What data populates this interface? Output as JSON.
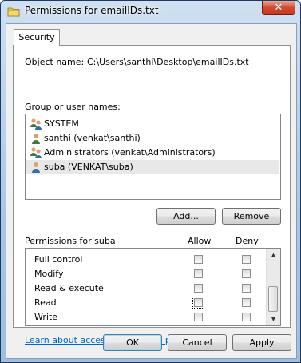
{
  "window": {
    "title": "Permissions for emailIDs.txt",
    "close_glyph": "✕",
    "icon": "folder-icon"
  },
  "tabs": [
    {
      "label": "Security"
    }
  ],
  "object": {
    "label": "Object name:",
    "value": "C:\\Users\\santhi\\Desktop\\emailIDs.txt"
  },
  "groups": {
    "label": "Group or user names:",
    "items": [
      {
        "name": "SYSTEM",
        "icon": "group-users-icon"
      },
      {
        "name": "santhi (venkat\\santhi)",
        "icon": "user-icon"
      },
      {
        "name": "Administrators (venkat\\Administrators)",
        "icon": "group-users-icon"
      },
      {
        "name": "suba (VENKAT\\suba)",
        "icon": "user-icon",
        "selected": true
      }
    ]
  },
  "buttons": {
    "add": "Add...",
    "remove": "Remove",
    "ok": "OK",
    "cancel": "Cancel",
    "apply": "Apply"
  },
  "permissions": {
    "label": "Permissions for suba",
    "col_allow": "Allow",
    "col_deny": "Deny",
    "rows": [
      {
        "name": "Full control",
        "allow": false,
        "deny": false
      },
      {
        "name": "Modify",
        "allow": false,
        "deny": false
      },
      {
        "name": "Read & execute",
        "allow": false,
        "deny": false
      },
      {
        "name": "Read",
        "allow": false,
        "deny": false
      },
      {
        "name": "Write",
        "allow": false,
        "deny": false
      }
    ]
  },
  "link": {
    "text": "Learn about access control and permissions"
  }
}
